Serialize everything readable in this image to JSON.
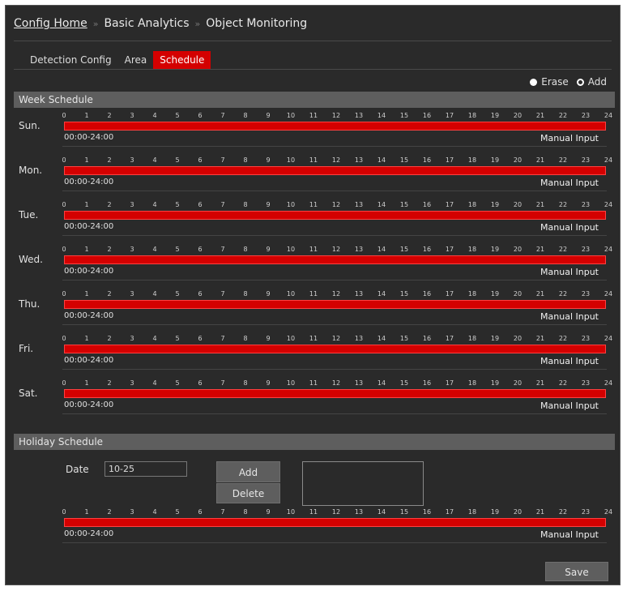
{
  "breadcrumb": {
    "home": "Config Home",
    "separator": "»",
    "level1": "Basic Analytics",
    "level2": "Object Monitoring"
  },
  "tabs": [
    {
      "label": "Detection Config",
      "active": false
    },
    {
      "label": "Area",
      "active": false
    },
    {
      "label": "Schedule",
      "active": true
    }
  ],
  "mode": {
    "erase_label": "Erase",
    "add_label": "Add",
    "selected": "Add"
  },
  "week_schedule": {
    "title": "Week Schedule",
    "hours": [
      "0",
      "1",
      "2",
      "3",
      "4",
      "5",
      "6",
      "7",
      "8",
      "9",
      "10",
      "11",
      "12",
      "13",
      "14",
      "15",
      "16",
      "17",
      "18",
      "19",
      "20",
      "21",
      "22",
      "23",
      "24"
    ],
    "days": [
      {
        "label": "Sun.",
        "range": "00:00-24:00",
        "manual": "Manual Input"
      },
      {
        "label": "Mon.",
        "range": "00:00-24:00",
        "manual": "Manual Input"
      },
      {
        "label": "Tue.",
        "range": "00:00-24:00",
        "manual": "Manual Input"
      },
      {
        "label": "Wed.",
        "range": "00:00-24:00",
        "manual": "Manual Input"
      },
      {
        "label": "Thu.",
        "range": "00:00-24:00",
        "manual": "Manual Input"
      },
      {
        "label": "Fri.",
        "range": "00:00-24:00",
        "manual": "Manual Input"
      },
      {
        "label": "Sat.",
        "range": "00:00-24:00",
        "manual": "Manual Input"
      }
    ]
  },
  "holiday_schedule": {
    "title": "Holiday Schedule",
    "date_label": "Date",
    "date_value": "10-25",
    "add_label": "Add",
    "delete_label": "Delete",
    "range": "00:00-24:00",
    "manual": "Manual Input"
  },
  "save_label": "Save",
  "colors": {
    "accent": "#d40000",
    "background": "#2a2a2a",
    "section_bar": "#5e5e5e"
  }
}
